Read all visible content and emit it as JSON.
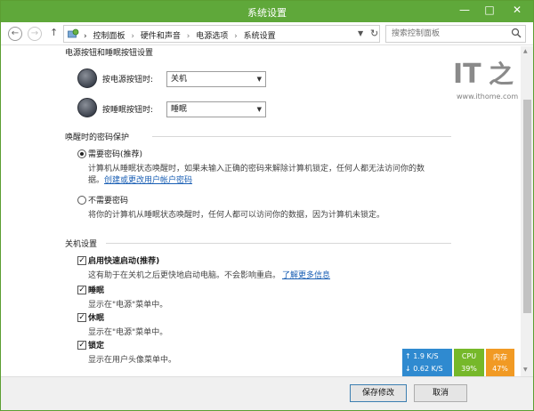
{
  "window": {
    "title": "系统设置",
    "min_glyph": "—",
    "max_glyph": "□",
    "close_glyph": "✕"
  },
  "nav": {
    "back_glyph": "←",
    "forward_glyph": "→",
    "up_glyph": "↑",
    "breadcrumb": [
      "控制面板",
      "硬件和声音",
      "电源选项",
      "系统设置"
    ],
    "separator": "›",
    "dropdown_glyph": "▼",
    "refresh_glyph": "↻",
    "search_placeholder": "搜索控制面板"
  },
  "power_section": {
    "heading": "电源按钮和睡眠按钮设置",
    "power_button_label": "按电源按钮时:",
    "power_button_value": "关机",
    "sleep_button_label": "按睡眠按钮时:",
    "sleep_button_value": "睡眠"
  },
  "password_section": {
    "heading": "唤醒时的密码保护",
    "require_label": "需要密码(推荐)",
    "require_desc_1": "计算机从睡眠状态唤醒时，如果未输入正确的密码来解除计算机锁定，任何人都无法访问你的数",
    "require_desc_2": "据。",
    "create_link": "创建或更改用户帐户密码",
    "no_require_label": "不需要密码",
    "no_require_desc": "将你的计算机从睡眠状态唤醒时，任何人都可以访问你的数据，因为计算机未锁定。"
  },
  "shutdown_section": {
    "heading": "关机设置",
    "fast_startup_label": "启用快速启动(推荐)",
    "fast_startup_desc": "这有助于在关机之后更快地启动电脑。不会影响重启。",
    "learn_more_link": "了解更多信息",
    "sleep_label": "睡眠",
    "sleep_desc": "显示在\"电源\"菜单中。",
    "hibernate_label": "休眠",
    "hibernate_desc": "显示在\"电源\"菜单中。",
    "lock_label": "锁定",
    "lock_desc": "显示在用户头像菜单中。",
    "check_glyph": "✓"
  },
  "footer": {
    "save_label": "保存修改",
    "cancel_label": "取消"
  },
  "watermark": {
    "url": "www.ithome.com"
  },
  "monitor": {
    "up_speed": "↑  1.9 K/S",
    "down_speed": "↓  0.62 K/S",
    "cpu_label": "CPU",
    "cpu_value": "39%",
    "mem_label": "内存",
    "mem_value": "47%"
  },
  "colors": {
    "title_bar": "#5fa83a",
    "link": "#1a5fb4",
    "net_panel": "#2f8ad0",
    "cpu_panel": "#76b82a",
    "mem_panel": "#f19a24"
  }
}
